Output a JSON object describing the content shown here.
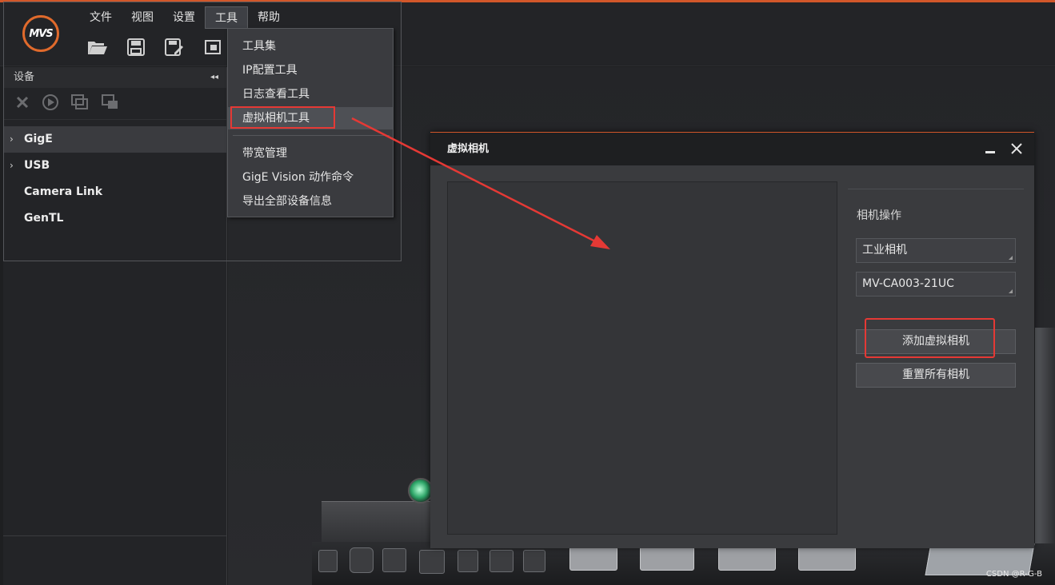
{
  "app": {
    "logo_text": "MVS",
    "accent_color": "#d2572a"
  },
  "menubar": {
    "items": [
      {
        "label": "文件"
      },
      {
        "label": "视图"
      },
      {
        "label": "设置"
      },
      {
        "label": "工具",
        "active": true
      },
      {
        "label": "帮助"
      }
    ]
  },
  "toolbar": {
    "icons": [
      "open-folder-icon",
      "save-icon",
      "save-as-icon",
      "window-icon"
    ]
  },
  "device_panel": {
    "title": "设备",
    "tool_icons": [
      "disconnect-icon",
      "play-icon",
      "copy-window-icon",
      "window-stack-icon"
    ],
    "items": [
      {
        "label": "GigE",
        "expandable": true,
        "selected": true
      },
      {
        "label": "USB",
        "expandable": true,
        "selected": false
      },
      {
        "label": "Camera Link",
        "expandable": false,
        "selected": false
      },
      {
        "label": "GenTL",
        "expandable": false,
        "selected": false
      }
    ]
  },
  "tools_menu": {
    "items": [
      {
        "label": "工具集"
      },
      {
        "label": "IP配置工具"
      },
      {
        "label": "日志查看工具"
      },
      {
        "label": "虚拟相机工具",
        "highlighted": true
      },
      {
        "label": "带宽管理"
      },
      {
        "label": "GigE Vision 动作命令"
      },
      {
        "label": "导出全部设备信息"
      }
    ]
  },
  "dialog": {
    "title": "虚拟相机",
    "ops_label": "相机操作",
    "camera_type": "工业相机",
    "camera_model": "MV-CA003-21UC",
    "add_button": "添加虚拟相机",
    "reset_button": "重置所有相机"
  },
  "annotation_color": "#e53935",
  "watermark": "CSDN @R-G-B"
}
